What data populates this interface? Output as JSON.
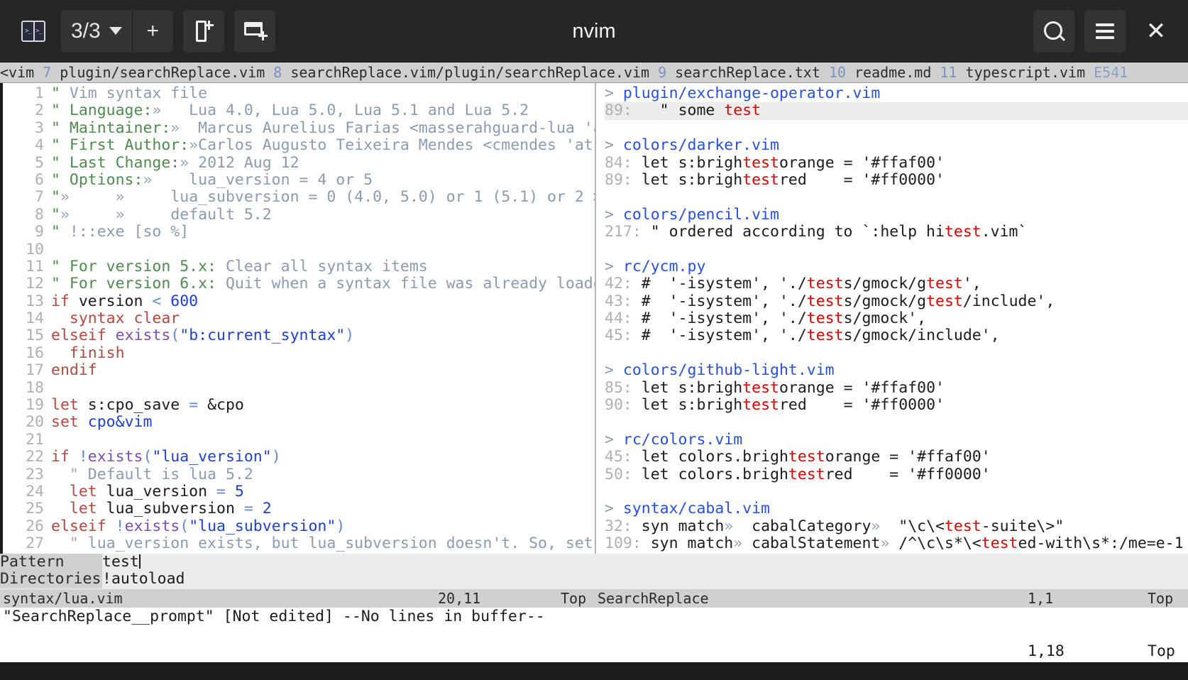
{
  "titlebar": {
    "app_title": "nvim",
    "logo_icon": "terminal-split-icon",
    "session_count": "3/3",
    "caret_icon": "chevron-down-icon",
    "new_tab_label": "+",
    "new_file_icon": "new-file-icon",
    "new_window_icon": "new-window-icon",
    "search_icon": "search-icon",
    "menu_icon": "hamburger-menu-icon",
    "close_icon": "close-icon",
    "bg": "#262626",
    "button_bg": "#333333"
  },
  "tabline": {
    "clipped_prefix": "<vim",
    "tabs": [
      {
        "num": "7",
        "name": "plugin/searchReplace.vim"
      },
      {
        "num": "8",
        "name": "searchReplace.vim/plugin/searchReplace.vim"
      },
      {
        "num": "9",
        "name": "searchReplace.txt"
      },
      {
        "num": "10",
        "name": "readme.md"
      },
      {
        "num": "11",
        "name": "typescript.vim"
      }
    ],
    "trailing": "E541"
  },
  "left_pane": {
    "file": "syntax/lua.vim",
    "lines": [
      {
        "n": "1",
        "parts": [
          {
            "t": "\" ",
            "c": "c-cmtq"
          },
          {
            "t": "Vim syntax file",
            "c": "c-cmt"
          }
        ]
      },
      {
        "n": "2",
        "parts": [
          {
            "t": "\" ",
            "c": "c-cmtq"
          },
          {
            "t": "Language:",
            "c": "c-cmtq"
          },
          {
            "t": "»",
            "c": "c-tabch"
          },
          {
            "t": "   Lua 4.0, Lua 5.0, Lua 5.1 and Lua 5.2",
            "c": "c-cmt"
          }
        ]
      },
      {
        "n": "3",
        "parts": [
          {
            "t": "\" ",
            "c": "c-cmtq"
          },
          {
            "t": "Maintainer:",
            "c": "c-cmtq"
          },
          {
            "t": "»",
            "c": "c-tabch"
          },
          {
            "t": "  Marcus Aurelius Farias <masserahguard-lua 'at'",
            "c": "c-cmt"
          },
          {
            "t": ">",
            "c": "c-op"
          }
        ]
      },
      {
        "n": "4",
        "parts": [
          {
            "t": "\" ",
            "c": "c-cmtq"
          },
          {
            "t": "First Author:",
            "c": "c-cmtq"
          },
          {
            "t": "»",
            "c": "c-tabch"
          },
          {
            "t": "Carlos Augusto Teixeira Mendes <cmendes 'at' i",
            "c": "c-cmt"
          },
          {
            "t": ">",
            "c": "c-op"
          }
        ]
      },
      {
        "n": "5",
        "parts": [
          {
            "t": "\" ",
            "c": "c-cmtq"
          },
          {
            "t": "Last Change:",
            "c": "c-cmtq"
          },
          {
            "t": "»",
            "c": "c-tabch"
          },
          {
            "t": " 2012 Aug 12",
            "c": "c-cmt"
          }
        ]
      },
      {
        "n": "6",
        "parts": [
          {
            "t": "\" ",
            "c": "c-cmtq"
          },
          {
            "t": "Options:",
            "c": "c-cmtq"
          },
          {
            "t": "»",
            "c": "c-tabch"
          },
          {
            "t": "    lua_version = 4 or 5",
            "c": "c-cmt"
          }
        ]
      },
      {
        "n": "7",
        "parts": [
          {
            "t": "\"",
            "c": "c-cmtq"
          },
          {
            "t": "»",
            "c": "c-tabch"
          },
          {
            "t": "     ",
            "c": "c-cmt"
          },
          {
            "t": "»",
            "c": "c-tabch"
          },
          {
            "t": "     lua_subversion = 0 (4.0, 5.0) or 1 (5.1) or 2 ",
            "c": "c-cmt"
          },
          {
            "t": ">",
            "c": "c-op"
          }
        ]
      },
      {
        "n": "8",
        "parts": [
          {
            "t": "\"",
            "c": "c-cmtq"
          },
          {
            "t": "»",
            "c": "c-tabch"
          },
          {
            "t": "     ",
            "c": "c-cmt"
          },
          {
            "t": "»",
            "c": "c-tabch"
          },
          {
            "t": "     default 5.2",
            "c": "c-cmt"
          }
        ]
      },
      {
        "n": "9",
        "parts": [
          {
            "t": "\" ",
            "c": "c-cmtq"
          },
          {
            "t": "!::exe [so %]",
            "c": "c-cmt"
          }
        ]
      },
      {
        "n": "10",
        "parts": []
      },
      {
        "n": "11",
        "parts": [
          {
            "t": "\" ",
            "c": "c-cmtq"
          },
          {
            "t": "For version 5.x:",
            "c": "c-cmtq"
          },
          {
            "t": " Clear all syntax items",
            "c": "c-cmt"
          }
        ]
      },
      {
        "n": "12",
        "parts": [
          {
            "t": "\" ",
            "c": "c-cmtq"
          },
          {
            "t": "For version 6.x:",
            "c": "c-cmtq"
          },
          {
            "t": " Quit when a syntax file was already loaded",
            "c": "c-cmt"
          }
        ]
      },
      {
        "n": "13",
        "parts": [
          {
            "t": "if",
            "c": "c-kw"
          },
          {
            "t": " version ",
            "c": "c-id"
          },
          {
            "t": "<",
            "c": "c-op"
          },
          {
            "t": " ",
            "c": "c-id"
          },
          {
            "t": "600",
            "c": "c-num"
          }
        ]
      },
      {
        "n": "14",
        "parts": [
          {
            "t": "  ",
            "c": "c-id"
          },
          {
            "t": "syntax clear",
            "c": "c-kw"
          }
        ]
      },
      {
        "n": "15",
        "parts": [
          {
            "t": "elseif",
            "c": "c-kw"
          },
          {
            "t": " ",
            "c": "c-id"
          },
          {
            "t": "exists",
            "c": "c-fn"
          },
          {
            "t": "(",
            "c": "c-op"
          },
          {
            "t": "\"b:current_syntax\"",
            "c": "c-str"
          },
          {
            "t": ")",
            "c": "c-op"
          }
        ]
      },
      {
        "n": "16",
        "parts": [
          {
            "t": "  ",
            "c": "c-id"
          },
          {
            "t": "finish",
            "c": "c-kw"
          }
        ]
      },
      {
        "n": "17",
        "parts": [
          {
            "t": "endif",
            "c": "c-kw"
          }
        ]
      },
      {
        "n": "18",
        "parts": []
      },
      {
        "n": "19",
        "parts": [
          {
            "t": "let",
            "c": "c-kw"
          },
          {
            "t": " s:cpo_save ",
            "c": "c-id"
          },
          {
            "t": "=",
            "c": "c-op"
          },
          {
            "t": " &cpo",
            "c": "c-id"
          }
        ]
      },
      {
        "n": "20",
        "parts": [
          {
            "t": "set",
            "c": "c-kw"
          },
          {
            "t": " ",
            "c": "c-id"
          },
          {
            "t": "cpo&vim",
            "c": "c-str"
          }
        ]
      },
      {
        "n": "21",
        "parts": []
      },
      {
        "n": "22",
        "parts": [
          {
            "t": "if",
            "c": "c-kw"
          },
          {
            "t": " ",
            "c": "c-id"
          },
          {
            "t": "!",
            "c": "c-op"
          },
          {
            "t": "exists",
            "c": "c-fn"
          },
          {
            "t": "(",
            "c": "c-op"
          },
          {
            "t": "\"lua_version\"",
            "c": "c-str"
          },
          {
            "t": ")",
            "c": "c-op"
          }
        ]
      },
      {
        "n": "23",
        "parts": [
          {
            "t": "  ",
            "c": "c-id"
          },
          {
            "t": "\" ",
            "c": "c-cmtq2"
          },
          {
            "t": "Default is lua 5.2",
            "c": "c-cmt"
          }
        ]
      },
      {
        "n": "24",
        "parts": [
          {
            "t": "  ",
            "c": "c-id"
          },
          {
            "t": "let",
            "c": "c-kw"
          },
          {
            "t": " lua_version ",
            "c": "c-id"
          },
          {
            "t": "=",
            "c": "c-op"
          },
          {
            "t": " ",
            "c": "c-id"
          },
          {
            "t": "5",
            "c": "c-num"
          }
        ]
      },
      {
        "n": "25",
        "parts": [
          {
            "t": "  ",
            "c": "c-id"
          },
          {
            "t": "let",
            "c": "c-kw"
          },
          {
            "t": " lua_subversion ",
            "c": "c-id"
          },
          {
            "t": "=",
            "c": "c-op"
          },
          {
            "t": " ",
            "c": "c-id"
          },
          {
            "t": "2",
            "c": "c-num"
          }
        ]
      },
      {
        "n": "26",
        "parts": [
          {
            "t": "elseif",
            "c": "c-kw"
          },
          {
            "t": " ",
            "c": "c-id"
          },
          {
            "t": "!",
            "c": "c-op"
          },
          {
            "t": "exists",
            "c": "c-fn"
          },
          {
            "t": "(",
            "c": "c-op"
          },
          {
            "t": "\"lua_subversion\"",
            "c": "c-str"
          },
          {
            "t": ")",
            "c": "c-op"
          }
        ]
      },
      {
        "n": "27",
        "parts": [
          {
            "t": "  ",
            "c": "c-id"
          },
          {
            "t": "\" ",
            "c": "c-cmtq2"
          },
          {
            "t": "lua_version exists, but lua_subversion doesn't. So, set it",
            "c": "c-cmt"
          },
          {
            "t": ">",
            "c": "c-op"
          }
        ]
      }
    ]
  },
  "right_pane": {
    "name": "SearchReplace",
    "groups": [
      {
        "chevron": ">",
        "file": "plugin/exchange-operator.vim",
        "results": [
          {
            "num": "89:",
            "current": true,
            "parts": [
              {
                "t": "   \" some ",
                "c": "res-txt"
              },
              {
                "t": "test",
                "c": "hl"
              }
            ]
          }
        ]
      },
      {
        "chevron": ">",
        "file": "colors/darker.vim",
        "results": [
          {
            "num": "84:",
            "parts": [
              {
                "t": " let s:brigh",
                "c": "res-txt"
              },
              {
                "t": "test",
                "c": "hl"
              },
              {
                "t": "orange = '#ffaf00'",
                "c": "res-txt"
              }
            ]
          },
          {
            "num": "89:",
            "parts": [
              {
                "t": " let s:brigh",
                "c": "res-txt"
              },
              {
                "t": "test",
                "c": "hl"
              },
              {
                "t": "red    = '#ff0000'",
                "c": "res-txt"
              }
            ]
          }
        ]
      },
      {
        "chevron": ">",
        "file": "colors/pencil.vim",
        "results": [
          {
            "num": "217:",
            "parts": [
              {
                "t": " \" ordered according to `:help hi",
                "c": "res-txt"
              },
              {
                "t": "test",
                "c": "hl"
              },
              {
                "t": ".vim`",
                "c": "res-txt"
              }
            ]
          }
        ]
      },
      {
        "chevron": ">",
        "file": "rc/ycm.py",
        "results": [
          {
            "num": "42:",
            "parts": [
              {
                "t": " #  '-isystem', './",
                "c": "res-txt"
              },
              {
                "t": "test",
                "c": "hl"
              },
              {
                "t": "s/gmock/g",
                "c": "res-txt"
              },
              {
                "t": "test",
                "c": "hl"
              },
              {
                "t": "',",
                "c": "res-txt"
              }
            ]
          },
          {
            "num": "43:",
            "parts": [
              {
                "t": " #  '-isystem', './",
                "c": "res-txt"
              },
              {
                "t": "test",
                "c": "hl"
              },
              {
                "t": "s/gmock/g",
                "c": "res-txt"
              },
              {
                "t": "test",
                "c": "hl"
              },
              {
                "t": "/include',",
                "c": "res-txt"
              }
            ]
          },
          {
            "num": "44:",
            "parts": [
              {
                "t": " #  '-isystem', './",
                "c": "res-txt"
              },
              {
                "t": "test",
                "c": "hl"
              },
              {
                "t": "s/gmock',",
                "c": "res-txt"
              }
            ]
          },
          {
            "num": "45:",
            "parts": [
              {
                "t": " #  '-isystem', './",
                "c": "res-txt"
              },
              {
                "t": "test",
                "c": "hl"
              },
              {
                "t": "s/gmock/include',",
                "c": "res-txt"
              }
            ]
          }
        ]
      },
      {
        "chevron": ">",
        "file": "colors/github-light.vim",
        "results": [
          {
            "num": "85:",
            "parts": [
              {
                "t": " let s:brigh",
                "c": "res-txt"
              },
              {
                "t": "test",
                "c": "hl"
              },
              {
                "t": "orange = '#ffaf00'",
                "c": "res-txt"
              }
            ]
          },
          {
            "num": "90:",
            "parts": [
              {
                "t": " let s:brigh",
                "c": "res-txt"
              },
              {
                "t": "test",
                "c": "hl"
              },
              {
                "t": "red    = '#ff0000'",
                "c": "res-txt"
              }
            ]
          }
        ]
      },
      {
        "chevron": ">",
        "file": "rc/colors.vim",
        "results": [
          {
            "num": "45:",
            "parts": [
              {
                "t": " let colors.brigh",
                "c": "res-txt"
              },
              {
                "t": "test",
                "c": "hl"
              },
              {
                "t": "orange = '#ffaf00'",
                "c": "res-txt"
              }
            ]
          },
          {
            "num": "50:",
            "parts": [
              {
                "t": " let colors.brigh",
                "c": "res-txt"
              },
              {
                "t": "test",
                "c": "hl"
              },
              {
                "t": "red    = '#ff0000'",
                "c": "res-txt"
              }
            ]
          }
        ]
      },
      {
        "chevron": ">",
        "file": "syntax/cabal.vim",
        "results": [
          {
            "num": "32:",
            "parts": [
              {
                "t": " syn match",
                "c": "res-txt"
              },
              {
                "t": "»",
                "c": "dim"
              },
              {
                "t": "  cabalCategory",
                "c": "res-txt"
              },
              {
                "t": "»",
                "c": "dim"
              },
              {
                "t": "  \"\\c\\<",
                "c": "res-txt"
              },
              {
                "t": "test",
                "c": "hl"
              },
              {
                "t": "-suite\\>\"",
                "c": "res-txt"
              }
            ]
          },
          {
            "num": "109:",
            "parts": [
              {
                "t": " syn match",
                "c": "res-txt"
              },
              {
                "t": "»",
                "c": "dim"
              },
              {
                "t": " cabalStatement",
                "c": "res-txt"
              },
              {
                "t": "»",
                "c": "dim"
              },
              {
                "t": " /^\\c\\s*\\<",
                "c": "res-txt"
              },
              {
                "t": "test",
                "c": "hl"
              },
              {
                "t": "ed-with\\s*:/me=e-1",
                "c": "res-txt"
              }
            ]
          }
        ]
      }
    ]
  },
  "prompt": {
    "rows": [
      {
        "label": "Pattern",
        "value": "test",
        "has_caret": true
      },
      {
        "label": "Directories",
        "value": "!autoload",
        "has_caret": false
      }
    ]
  },
  "statusline": {
    "left_file": "syntax/lua.vim",
    "left_pos": "20,11",
    "left_scroll": "Top",
    "right_name": "SearchReplace",
    "right_pos": "1,1",
    "right_scroll": "Top"
  },
  "cmdline": {
    "message": "\"SearchReplace__prompt\" [Not edited] --No lines in buffer--",
    "pos": "1,18",
    "scroll": "Top"
  }
}
